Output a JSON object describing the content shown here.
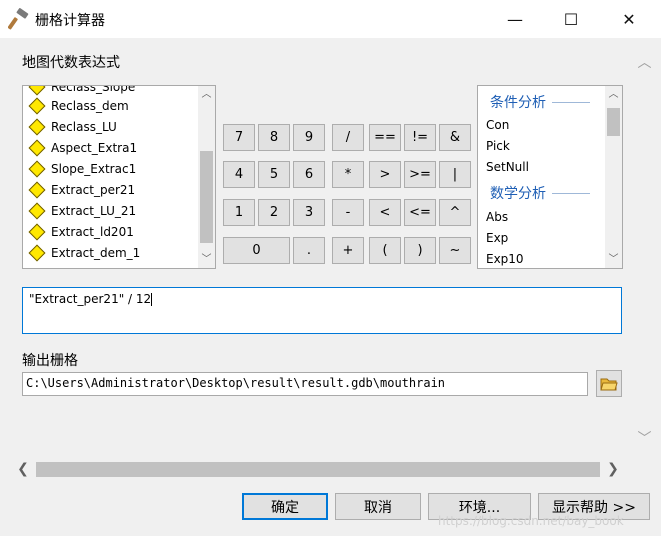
{
  "window": {
    "title": "栅格计算器",
    "minimize_glyph": "—",
    "maximize_glyph": "☐",
    "close_glyph": "✕"
  },
  "map_algebra": {
    "label": "地图代数表达式",
    "layers": [
      "Reclass_Slope",
      "Reclass_dem",
      "Reclass_LU",
      "Aspect_Extra1",
      "Slope_Extrac1",
      "Extract_per21",
      "Extract_LU_21",
      "Extract_ld201",
      "Extract_dem_1"
    ]
  },
  "keypad": {
    "rows": [
      [
        "7",
        "8",
        "9",
        "/",
        "==",
        "!=",
        "&"
      ],
      [
        "4",
        "5",
        "6",
        "*",
        ">",
        ">=",
        "|"
      ],
      [
        "1",
        "2",
        "3",
        "-",
        "<",
        "<=",
        "^"
      ],
      [
        "0",
        ".",
        "+",
        "(",
        ")",
        "~"
      ]
    ]
  },
  "functions": {
    "group1_title": "条件分析",
    "group1_items": [
      "Con",
      "Pick",
      "SetNull"
    ],
    "group2_title": "数学分析",
    "group2_items": [
      "Abs",
      "Exp",
      "Exp10"
    ]
  },
  "expression": {
    "value": "\"Extract_per21\" / 12"
  },
  "output": {
    "label": "输出栅格",
    "value": "C:\\Users\\Administrator\\Desktop\\result\\result.gdb\\mouthrain"
  },
  "buttons": {
    "ok": "确定",
    "cancel": "取消",
    "environments": "环境...",
    "show_help": "显示帮助 >>"
  },
  "watermark": "https://blog.csdn.net/bay_book"
}
